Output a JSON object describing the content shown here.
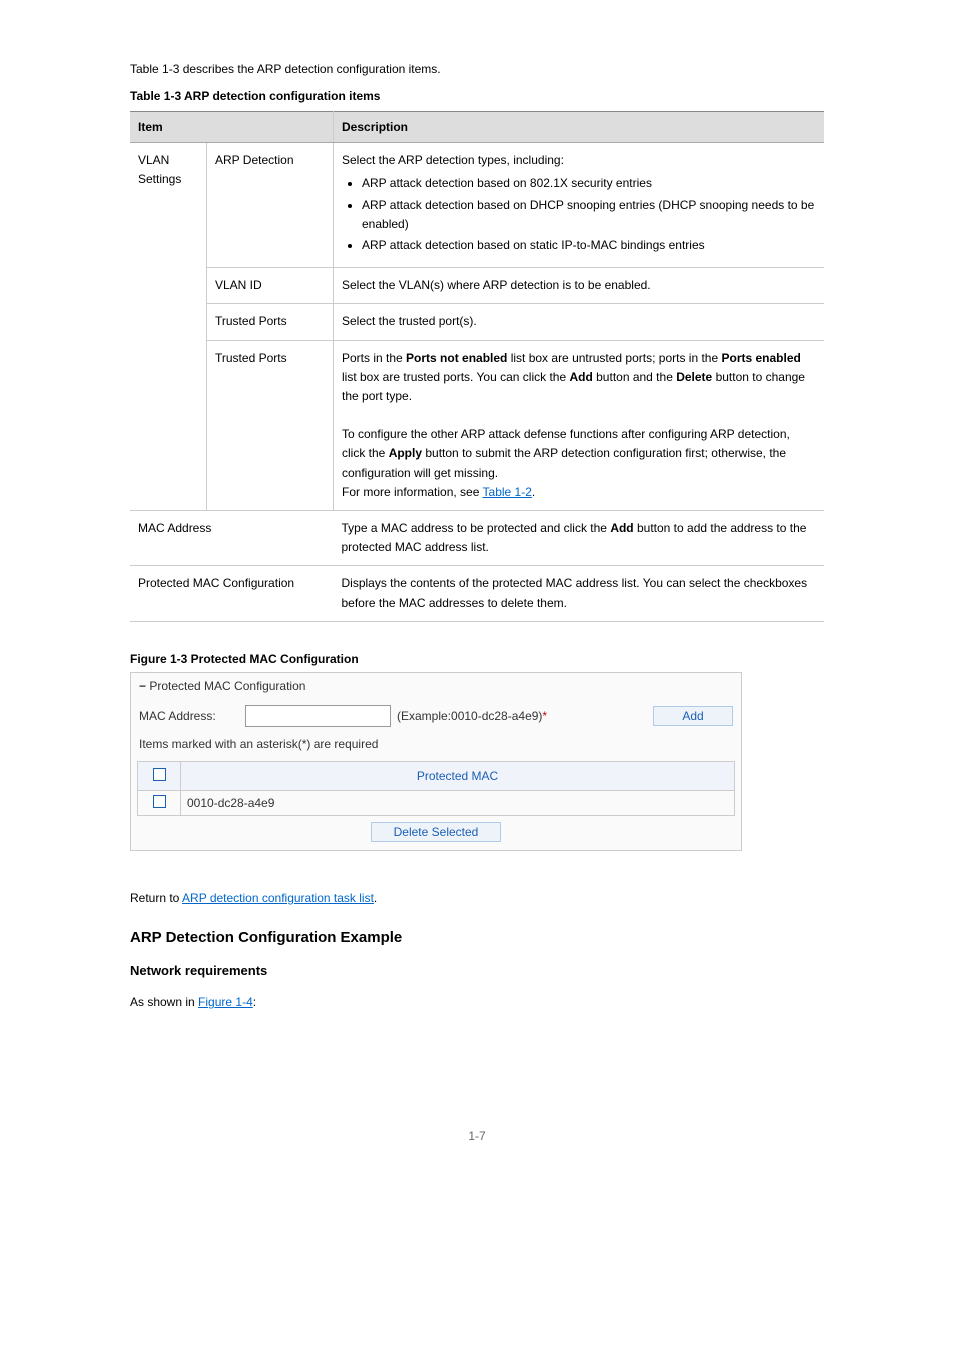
{
  "page_number": "1-7",
  "intro": "Table 1-3 describes the ARP detection configuration items.",
  "table3_caption": "Table 1-3 ARP detection configuration items",
  "headers": {
    "item": "Item",
    "desc": "Description"
  },
  "rows": {
    "vlan_label": "VLAN Settings",
    "arp_det": {
      "label": "ARP Detection",
      "lead": "Select the ARP detection types, including:",
      "b1": "ARP attack detection based on 802.1X security entries",
      "b2": "ARP attack detection based on DHCP snooping entries (DHCP snooping needs to be enabled)",
      "b3": "ARP attack detection based on static IP-to-MAC bindings entries"
    },
    "vlan_id": {
      "label": "VLAN ID",
      "desc": "Select the VLAN(s) where ARP detection is to be enabled."
    },
    "trust_port": {
      "label": "Trusted Ports",
      "desc": "Select the trusted port(s)."
    },
    "trust_ports": {
      "label": "Trusted Ports",
      "desc_pre": "Ports in the ",
      "bold1": "Ports not enabled",
      "desc_mid1": " list box are untrusted ports; ports in the ",
      "bold2": "Ports enabled",
      "desc_mid2": " list box are trusted ports. You can click the ",
      "bold3": "Add",
      "desc_mid3": " button and the ",
      "bold4": "Delete",
      "desc_mid4": " button to change the port type.",
      "desc2_pre": "To configure the other ARP attack defense functions after configuring ARP detection, click the ",
      "bold5": "Apply",
      "desc2_mid": " button to submit the ARP detection configuration first; otherwise, the configuration will get missing.",
      "link": "Table 1-2"
    },
    "mac_addr": {
      "label": "MAC Address",
      "desc_pre": "Type a MAC address to be protected and click the ",
      "bold": "Add",
      "desc_post": " button to add the address to the protected MAC address list."
    },
    "pmac": {
      "label": "Protected MAC Configuration",
      "desc": "Displays the contents of the protected MAC address list. You can select the checkboxes before the MAC addresses to delete them."
    }
  },
  "example_heading": "ARP Detection Configuration Example",
  "network_reqs_heading": "Network requirements",
  "network_reqs_text": "As shown in Figure 1-4:",
  "figure3_caption": "Figure 1-3 Protected MAC Configuration",
  "ui": {
    "section_title": "Protected MAC Configuration",
    "mac_label": "MAC Address:",
    "example": "(Example:0010-dc28-a4e9)",
    "asterisk": "*",
    "add_btn": "Add",
    "note": "Items marked with an asterisk(*) are required",
    "table_header": "Protected MAC",
    "rows": [
      {
        "mac": "0010-dc28-a4e9"
      }
    ],
    "delete_btn": "Delete Selected"
  },
  "return_text": "Return to ARP detection configuration task list."
}
